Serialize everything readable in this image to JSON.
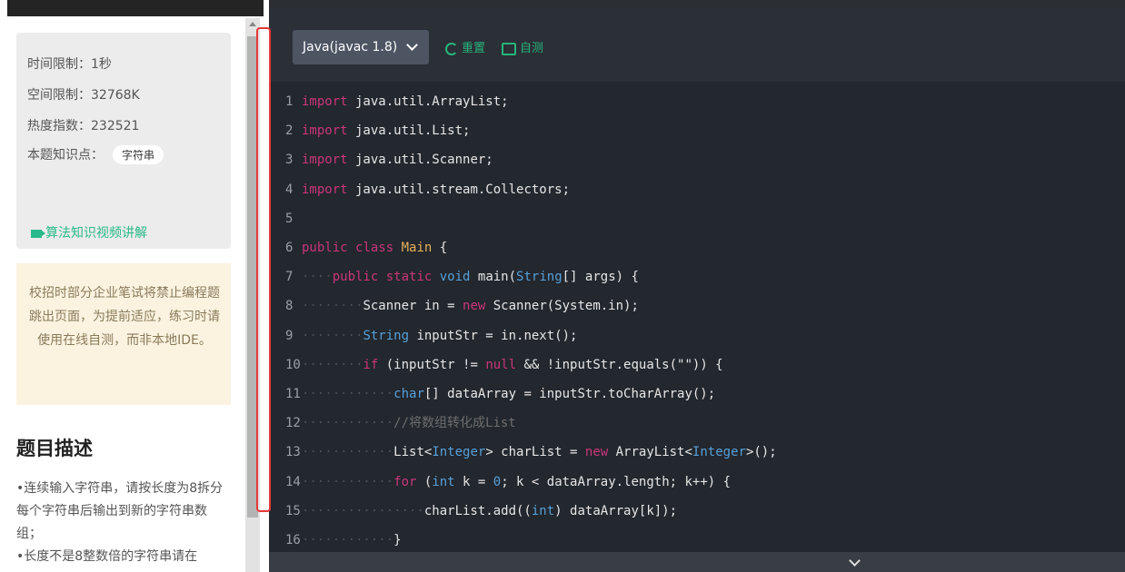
{
  "problem_info": {
    "time_limit": "时间限制：1秒",
    "space_limit": "空间限制：32768K",
    "heat_index": "热度指数：232521",
    "knowledge_label": "本题知识点：",
    "knowledge_tag": "字符串",
    "video_link": "算法知识视频讲解"
  },
  "notice": {
    "text": "校招时部分企业笔试将禁止编程题跳出页面，为提前适应，练习时请使用在线自测，而非本地IDE。"
  },
  "description": {
    "title": "题目描述",
    "lines": [
      "•连续输入字符串，请按长度为8拆分每个字符串后输出到新的字符串数组；",
      "•长度不是8整数倍的字符串请在"
    ]
  },
  "editor": {
    "language": "Java(javac 1.8)",
    "reset_label": "重置",
    "test_label": "自测",
    "icons": [
      "refresh-icon",
      "comment-icon",
      "chevron-down-icon",
      "video-camera-icon"
    ],
    "colors": {
      "accent": "#27b57c",
      "keyword": "#c9367a",
      "type": "#56a0d8",
      "class": "#e7b15a",
      "highlight_box": "#e53935"
    },
    "line_numbers": [
      "1",
      "2",
      "3",
      "4",
      "5",
      "6",
      "7",
      "8",
      "9",
      "10",
      "11",
      "12",
      "13",
      "14",
      "15",
      "16"
    ],
    "code": [
      "import java.util.ArrayList;",
      "import java.util.List;",
      "import java.util.Scanner;",
      "import java.util.stream.Collectors;",
      "",
      "public class Main {",
      "    public static void main(String[] args) {",
      "        Scanner in = new Scanner(System.in);",
      "        String inputStr = in.next();",
      "        if (inputStr != null && !inputStr.equals(\"\")) {",
      "            char[] dataArray = inputStr.toCharArray();",
      "            //将数组转化成List",
      "            List<Integer> charList = new ArrayList<Integer>();",
      "            for (int k = 0; k < dataArray.length; k++) {",
      "                charList.add((int) dataArray[k]);",
      "            }"
    ]
  }
}
